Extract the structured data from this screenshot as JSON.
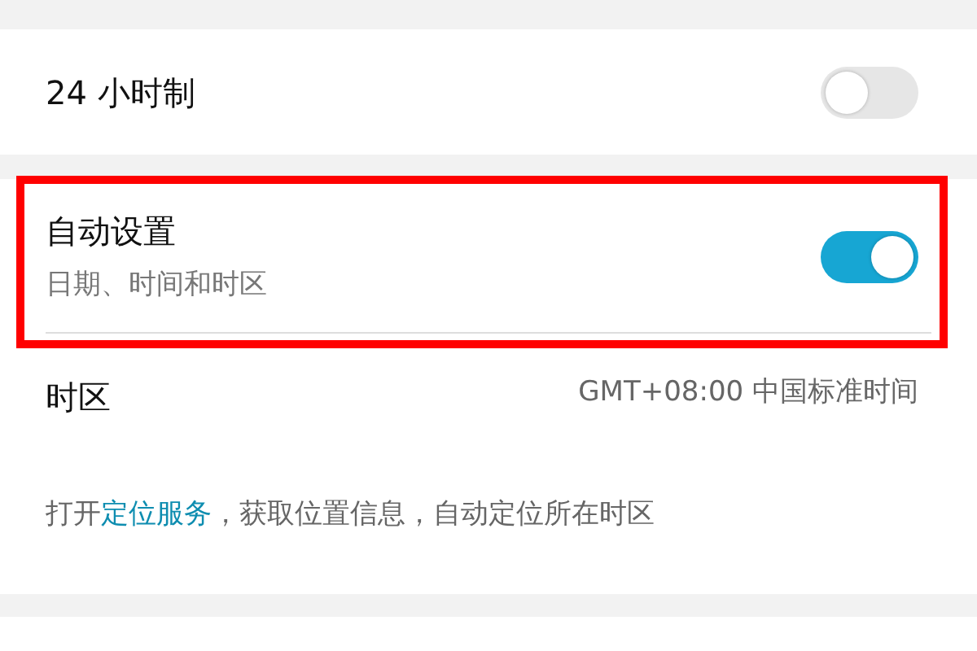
{
  "rows": [
    {
      "kind": "switch",
      "title": "24 小时制",
      "on": false,
      "highlighted": false
    },
    {
      "kind": "switch",
      "title": "自动设置",
      "subtitle": "日期、时间和时区",
      "on": true,
      "highlighted": true
    },
    {
      "kind": "value",
      "title": "时区",
      "value": "GMT+08:00 中国标准时间",
      "highlighted": false
    }
  ],
  "note": {
    "before": "打开",
    "link": "定位服务",
    "after": "，获取位置信息，自动定位所在时区"
  }
}
